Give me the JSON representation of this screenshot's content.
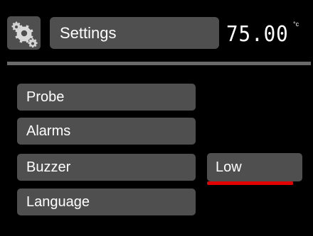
{
  "header": {
    "icon": "gear-icon",
    "title": "Settings",
    "temperature": "75.00",
    "temperature_unit": "°c"
  },
  "menu": {
    "items": [
      {
        "label": "Probe"
      },
      {
        "label": "Alarms"
      },
      {
        "label": "Buzzer"
      },
      {
        "label": "Language"
      }
    ]
  },
  "selection": {
    "value": "Low",
    "underline_color": "#e30000"
  },
  "colors": {
    "background": "#000000",
    "button": "#4f4f4f",
    "divider": "#6a6a6a",
    "text": "#ffffff",
    "accent": "#e30000"
  }
}
